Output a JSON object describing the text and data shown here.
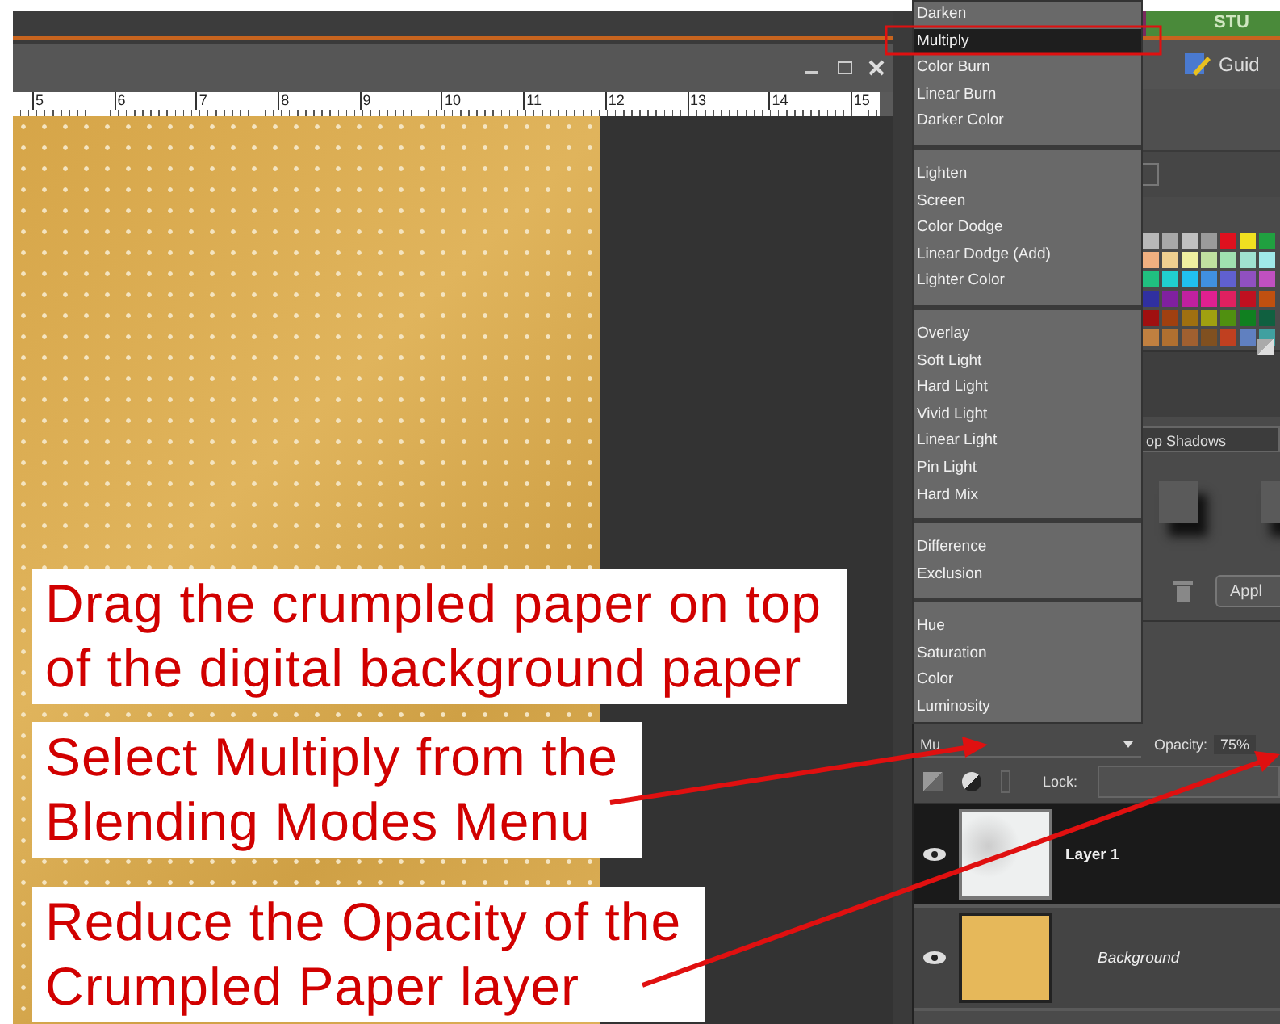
{
  "top_bar": {
    "studio_tab": "STU",
    "guide_button": "Guid"
  },
  "document_window": {
    "ruler_labels": [
      "5",
      "6",
      "7",
      "8",
      "9",
      "10",
      "11",
      "12",
      "13",
      "14",
      "15"
    ]
  },
  "blend_menu": {
    "groups": [
      {
        "items": [
          {
            "label": "Darken",
            "selected": false
          },
          {
            "label": "Multiply",
            "selected": true
          },
          {
            "label": "Color Burn",
            "selected": false
          },
          {
            "label": "Linear Burn",
            "selected": false
          },
          {
            "label": "Darker Color",
            "selected": false
          }
        ]
      },
      {
        "items": [
          {
            "label": "Lighten",
            "selected": false
          },
          {
            "label": "Screen",
            "selected": false
          },
          {
            "label": "Color Dodge",
            "selected": false
          },
          {
            "label": "Linear Dodge (Add)",
            "selected": false
          },
          {
            "label": "Lighter Color",
            "selected": false
          }
        ]
      },
      {
        "items": [
          {
            "label": "Overlay",
            "selected": false
          },
          {
            "label": "Soft Light",
            "selected": false
          },
          {
            "label": "Hard Light",
            "selected": false
          },
          {
            "label": "Vivid Light",
            "selected": false
          },
          {
            "label": "Linear Light",
            "selected": false
          },
          {
            "label": "Pin Light",
            "selected": false
          },
          {
            "label": "Hard Mix",
            "selected": false
          }
        ]
      },
      {
        "items": [
          {
            "label": "Difference",
            "selected": false
          },
          {
            "label": "Exclusion",
            "selected": false
          }
        ]
      },
      {
        "items": [
          {
            "label": "Hue",
            "selected": false
          },
          {
            "label": "Saturation",
            "selected": false
          },
          {
            "label": "Color",
            "selected": false
          },
          {
            "label": "Luminosity",
            "selected": false
          }
        ]
      }
    ]
  },
  "effects_panel": {
    "effect_dropdown": "op Shadows",
    "apply_button": "Appl"
  },
  "layers_panel": {
    "blend_mode": "Mu",
    "opacity_label": "Opacity:",
    "opacity_value": "75%",
    "lock_label": "Lock:",
    "layers": [
      {
        "name": "Layer 1",
        "selected": true,
        "kind": "texture"
      },
      {
        "name": "Background",
        "selected": false,
        "kind": "background"
      }
    ]
  },
  "annotations": [
    {
      "lines": [
        "Drag the crumpled paper on top",
        "of the digital background paper"
      ],
      "arrow": false
    },
    {
      "lines": [
        "Select Multiply from the",
        "Blending Modes Menu"
      ],
      "arrow": true
    },
    {
      "lines": [
        "Reduce the Opacity of the",
        "Crumpled Paper layer"
      ],
      "arrow": true
    }
  ]
}
